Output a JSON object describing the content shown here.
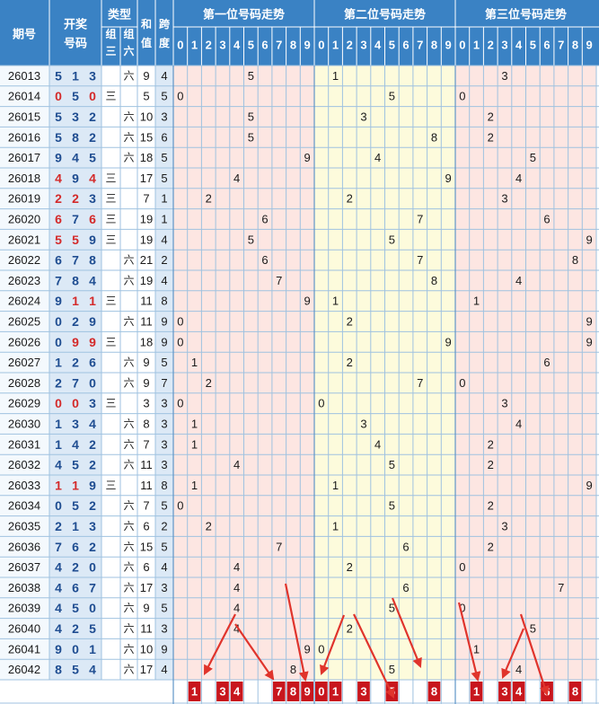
{
  "header": {
    "issue_label": "期号",
    "draw_label_1": "开奖",
    "draw_label_2": "号码",
    "type_label": "类型",
    "g3_label_1": "组",
    "g3_label_2": "三",
    "g6_label_1": "组",
    "g6_label_2": "六",
    "sum_label_1": "和",
    "sum_label_2": "值",
    "span_label_1": "跨",
    "span_label_2": "度",
    "zone1_title": "第一位号码走势",
    "zone2_title": "第二位号码走势",
    "zone3_title": "第三位号码走势",
    "digits": [
      "0",
      "1",
      "2",
      "3",
      "4",
      "5",
      "6",
      "7",
      "8",
      "9"
    ]
  },
  "table": {
    "g3_text": "三",
    "g6_text": "六",
    "rows": [
      {
        "issue": "26013",
        "n": [
          5,
          1,
          3
        ],
        "type": "g6",
        "sum": 9,
        "span": 4
      },
      {
        "issue": "26014",
        "n": [
          0,
          5,
          0
        ],
        "type": "g3",
        "sum": 5,
        "span": 5
      },
      {
        "issue": "26015",
        "n": [
          5,
          3,
          2
        ],
        "type": "g6",
        "sum": 10,
        "span": 3
      },
      {
        "issue": "26016",
        "n": [
          5,
          8,
          2
        ],
        "type": "g6",
        "sum": 15,
        "span": 6
      },
      {
        "issue": "26017",
        "n": [
          9,
          4,
          5
        ],
        "type": "g6",
        "sum": 18,
        "span": 5
      },
      {
        "issue": "26018",
        "n": [
          4,
          9,
          4
        ],
        "type": "g3",
        "sum": 17,
        "span": 5
      },
      {
        "issue": "26019",
        "n": [
          2,
          2,
          3
        ],
        "type": "g3",
        "sum": 7,
        "span": 1
      },
      {
        "issue": "26020",
        "n": [
          6,
          7,
          6
        ],
        "type": "g3",
        "sum": 19,
        "span": 1
      },
      {
        "issue": "26021",
        "n": [
          5,
          5,
          9
        ],
        "type": "g3",
        "sum": 19,
        "span": 4
      },
      {
        "issue": "26022",
        "n": [
          6,
          7,
          8
        ],
        "type": "g6",
        "sum": 21,
        "span": 2
      },
      {
        "issue": "26023",
        "n": [
          7,
          8,
          4
        ],
        "type": "g6",
        "sum": 19,
        "span": 4
      },
      {
        "issue": "26024",
        "n": [
          9,
          1,
          1
        ],
        "type": "g3",
        "sum": 11,
        "span": 8
      },
      {
        "issue": "26025",
        "n": [
          0,
          2,
          9
        ],
        "type": "g6",
        "sum": 11,
        "span": 9
      },
      {
        "issue": "26026",
        "n": [
          0,
          9,
          9
        ],
        "type": "g3",
        "sum": 18,
        "span": 9
      },
      {
        "issue": "26027",
        "n": [
          1,
          2,
          6
        ],
        "type": "g6",
        "sum": 9,
        "span": 5
      },
      {
        "issue": "26028",
        "n": [
          2,
          7,
          0
        ],
        "type": "g6",
        "sum": 9,
        "span": 7
      },
      {
        "issue": "26029",
        "n": [
          0,
          0,
          3
        ],
        "type": "g3",
        "sum": 3,
        "span": 3
      },
      {
        "issue": "26030",
        "n": [
          1,
          3,
          4
        ],
        "type": "g6",
        "sum": 8,
        "span": 3
      },
      {
        "issue": "26031",
        "n": [
          1,
          4,
          2
        ],
        "type": "g6",
        "sum": 7,
        "span": 3
      },
      {
        "issue": "26032",
        "n": [
          4,
          5,
          2
        ],
        "type": "g6",
        "sum": 11,
        "span": 3
      },
      {
        "issue": "26033",
        "n": [
          1,
          1,
          9
        ],
        "type": "g3",
        "sum": 11,
        "span": 8
      },
      {
        "issue": "26034",
        "n": [
          0,
          5,
          2
        ],
        "type": "g6",
        "sum": 7,
        "span": 5
      },
      {
        "issue": "26035",
        "n": [
          2,
          1,
          3
        ],
        "type": "g6",
        "sum": 6,
        "span": 2
      },
      {
        "issue": "26036",
        "n": [
          7,
          6,
          2
        ],
        "type": "g6",
        "sum": 15,
        "span": 5
      },
      {
        "issue": "26037",
        "n": [
          4,
          2,
          0
        ],
        "type": "g6",
        "sum": 6,
        "span": 4
      },
      {
        "issue": "26038",
        "n": [
          4,
          6,
          7
        ],
        "type": "g6",
        "sum": 17,
        "span": 3
      },
      {
        "issue": "26039",
        "n": [
          4,
          5,
          0
        ],
        "type": "g6",
        "sum": 9,
        "span": 5
      },
      {
        "issue": "26040",
        "n": [
          4,
          2,
          5
        ],
        "type": "g6",
        "sum": 11,
        "span": 3
      },
      {
        "issue": "26041",
        "n": [
          9,
          0,
          1
        ],
        "type": "g6",
        "sum": 10,
        "span": 9
      },
      {
        "issue": "26042",
        "n": [
          8,
          5,
          4
        ],
        "type": "g6",
        "sum": 17,
        "span": 4
      }
    ]
  },
  "predictions": {
    "zone1": [
      1,
      3,
      4,
      7,
      8,
      9
    ],
    "zone2": [
      0,
      1,
      3,
      5,
      8
    ],
    "zone3": [
      1,
      3,
      4,
      6,
      8
    ]
  },
  "colors": {
    "header_blue": "#3a82c4",
    "grid_line": "#9fc2e0",
    "repeat_red": "#d42a2a",
    "number_blue": "#1f4d91",
    "zone1_bg": "#fde6e2",
    "zone2_bg": "#fdfbdc",
    "zone3_bg": "#fde6e2",
    "issue_bg": "#f4f9fd",
    "draw_bg": "#dce9f6",
    "pred_box": "#c8161d",
    "arrow": "#e0342c"
  }
}
